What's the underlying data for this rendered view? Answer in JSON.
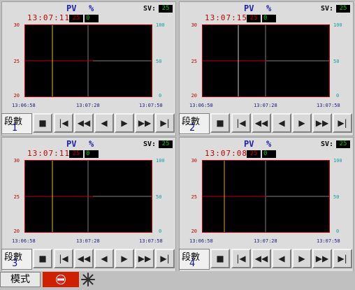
{
  "panels": [
    {
      "pv_label": "PV",
      "pct_label": "%",
      "sv_label": "SV:",
      "sv_value": "25",
      "time": "13:07:11",
      "red_value": "25",
      "green_value": "0",
      "y_left": [
        "30",
        "25",
        "20"
      ],
      "y_right": [
        "100",
        "50",
        "0"
      ],
      "x_ticks": [
        "13:06:58",
        "13:07:28",
        "13:07:58"
      ],
      "segment_label": "段數",
      "segment_num": "1"
    },
    {
      "pv_label": "PV",
      "pct_label": "%",
      "sv_label": "SV:",
      "sv_value": "25",
      "time": "13:07:15",
      "red_value": "25",
      "green_value": "0",
      "y_left": [
        "30",
        "25",
        "20"
      ],
      "y_right": [
        "100",
        "50",
        "0"
      ],
      "x_ticks": [
        "13:06:58",
        "13:07:28",
        "13:07:58"
      ],
      "segment_label": "段數",
      "segment_num": "2"
    },
    {
      "pv_label": "PV",
      "pct_label": "%",
      "sv_label": "SV:",
      "sv_value": "25",
      "time": "13:07:11",
      "red_value": "25",
      "green_value": "0",
      "y_left": [
        "30",
        "25",
        "20"
      ],
      "y_right": [
        "100",
        "50",
        "0"
      ],
      "x_ticks": [
        "13:06:58",
        "13:07:28",
        "13:07:58"
      ],
      "segment_label": "段數",
      "segment_num": "3"
    },
    {
      "pv_label": "PV",
      "pct_label": "%",
      "sv_label": "SV:",
      "sv_value": "25",
      "time": "13:07:08",
      "red_value": "25",
      "green_value": "0",
      "y_left": [
        "30",
        "25",
        "20"
      ],
      "y_right": [
        "100",
        "50",
        "0"
      ],
      "x_ticks": [
        "13:06:58",
        "13:07:28",
        "13:07:58"
      ],
      "segment_label": "段數",
      "segment_num": "4"
    }
  ],
  "toolbar_icons": [
    "stop-icon",
    "skip-to-start-icon",
    "rewind-icon",
    "step-back-icon",
    "step-forward-icon",
    "fast-forward-icon",
    "skip-to-end-icon"
  ],
  "toolbar_glyphs": [
    "■",
    "|◀",
    "◀◀",
    "◀",
    "▶",
    "▶▶",
    "▶|"
  ],
  "bottom": {
    "mode_label": "模式",
    "stop_icon": "no-entry-icon",
    "fan_icon": "snowflake-icon"
  },
  "colors": {
    "pv_trace": "#c00000",
    "sv_trace": "#10c010",
    "cursor": "#e0c040",
    "grid": "#808080"
  }
}
